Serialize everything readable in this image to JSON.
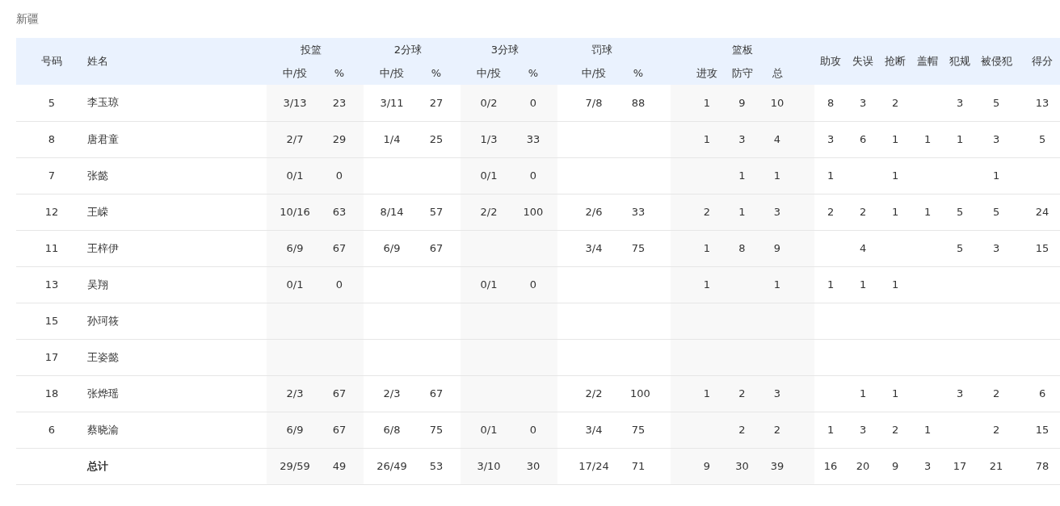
{
  "title": "新疆",
  "table": {
    "columns": [
      {
        "kind": "single",
        "label": "号码"
      },
      {
        "kind": "single",
        "label": "姓名"
      },
      {
        "kind": "group",
        "label": "投篮",
        "colspan": 2,
        "subcolumns": [
          "中/投",
          "%"
        ]
      },
      {
        "kind": "group",
        "label": "2分球",
        "colspan": 2,
        "subcolumns": [
          "中/投",
          "%"
        ]
      },
      {
        "kind": "group",
        "label": "3分球",
        "colspan": 2,
        "subcolumns": [
          "中/投",
          "%"
        ]
      },
      {
        "kind": "group",
        "label": "罚球",
        "colspan": 2,
        "subcolumns": [
          "中/投",
          "%"
        ]
      },
      {
        "kind": "group",
        "label": "篮板",
        "colspan": 3,
        "subcolumns": [
          "进攻",
          "防守",
          "总"
        ]
      },
      {
        "kind": "single",
        "label": "助攻"
      },
      {
        "kind": "single",
        "label": "失误"
      },
      {
        "kind": "single",
        "label": "抢断"
      },
      {
        "kind": "single",
        "label": "盖帽"
      },
      {
        "kind": "single",
        "label": "犯规"
      },
      {
        "kind": "single",
        "label": "被侵犯"
      },
      {
        "kind": "single",
        "label": "得分"
      }
    ],
    "rows": [
      {
        "kind": "player",
        "cells": [
          "5",
          "李玉琼",
          "3/13",
          "23",
          "3/11",
          "27",
          "0/2",
          "0",
          "7/8",
          "88",
          "1",
          "9",
          "10",
          "8",
          "3",
          "2",
          null,
          "3",
          "5",
          "13"
        ]
      },
      {
        "kind": "player",
        "cells": [
          "8",
          "唐君童",
          "2/7",
          "29",
          "1/4",
          "25",
          "1/3",
          "33",
          null,
          null,
          "1",
          "3",
          "4",
          "3",
          "6",
          "1",
          "1",
          "1",
          "3",
          "5"
        ]
      },
      {
        "kind": "player",
        "cells": [
          "7",
          "张懿",
          "0/1",
          "0",
          null,
          null,
          "0/1",
          "0",
          null,
          null,
          null,
          "1",
          "1",
          "1",
          null,
          "1",
          null,
          null,
          "1",
          null
        ]
      },
      {
        "kind": "player",
        "cells": [
          "12",
          "王嵘",
          "10/16",
          "63",
          "8/14",
          "57",
          "2/2",
          "100",
          "2/6",
          "33",
          "2",
          "1",
          "3",
          "2",
          "2",
          "1",
          "1",
          "5",
          "5",
          "24"
        ]
      },
      {
        "kind": "player",
        "cells": [
          "11",
          "王梓伊",
          "6/9",
          "67",
          "6/9",
          "67",
          null,
          null,
          "3/4",
          "75",
          "1",
          "8",
          "9",
          null,
          "4",
          null,
          null,
          "5",
          "3",
          "15"
        ]
      },
      {
        "kind": "player",
        "cells": [
          "13",
          "吴翔",
          "0/1",
          "0",
          null,
          null,
          "0/1",
          "0",
          null,
          null,
          "1",
          null,
          "1",
          "1",
          "1",
          "1",
          null,
          null,
          null,
          null
        ]
      },
      {
        "kind": "player",
        "cells": [
          "15",
          "孙珂筱",
          null,
          null,
          null,
          null,
          null,
          null,
          null,
          null,
          null,
          null,
          null,
          null,
          null,
          null,
          null,
          null,
          null,
          null
        ]
      },
      {
        "kind": "player",
        "cells": [
          "17",
          "王姿懿",
          null,
          null,
          null,
          null,
          null,
          null,
          null,
          null,
          null,
          null,
          null,
          null,
          null,
          null,
          null,
          null,
          null,
          null
        ]
      },
      {
        "kind": "player",
        "cells": [
          "18",
          "张烨瑶",
          "2/3",
          "67",
          "2/3",
          "67",
          null,
          null,
          "2/2",
          "100",
          "1",
          "2",
          "3",
          null,
          "1",
          "1",
          null,
          "3",
          "2",
          "6"
        ]
      },
      {
        "kind": "player",
        "cells": [
          "6",
          "蔡晓渝",
          "6/9",
          "67",
          "6/8",
          "75",
          "0/1",
          "0",
          "3/4",
          "75",
          null,
          "2",
          "2",
          "1",
          "3",
          "2",
          "1",
          null,
          "2",
          "15"
        ]
      },
      {
        "kind": "total",
        "cells": [
          null,
          "总计",
          "29/59",
          "49",
          "26/49",
          "53",
          "3/10",
          "30",
          "17/24",
          "71",
          "9",
          "30",
          "39",
          "16",
          "20",
          "9",
          "3",
          "17",
          "21",
          "78"
        ]
      }
    ]
  }
}
